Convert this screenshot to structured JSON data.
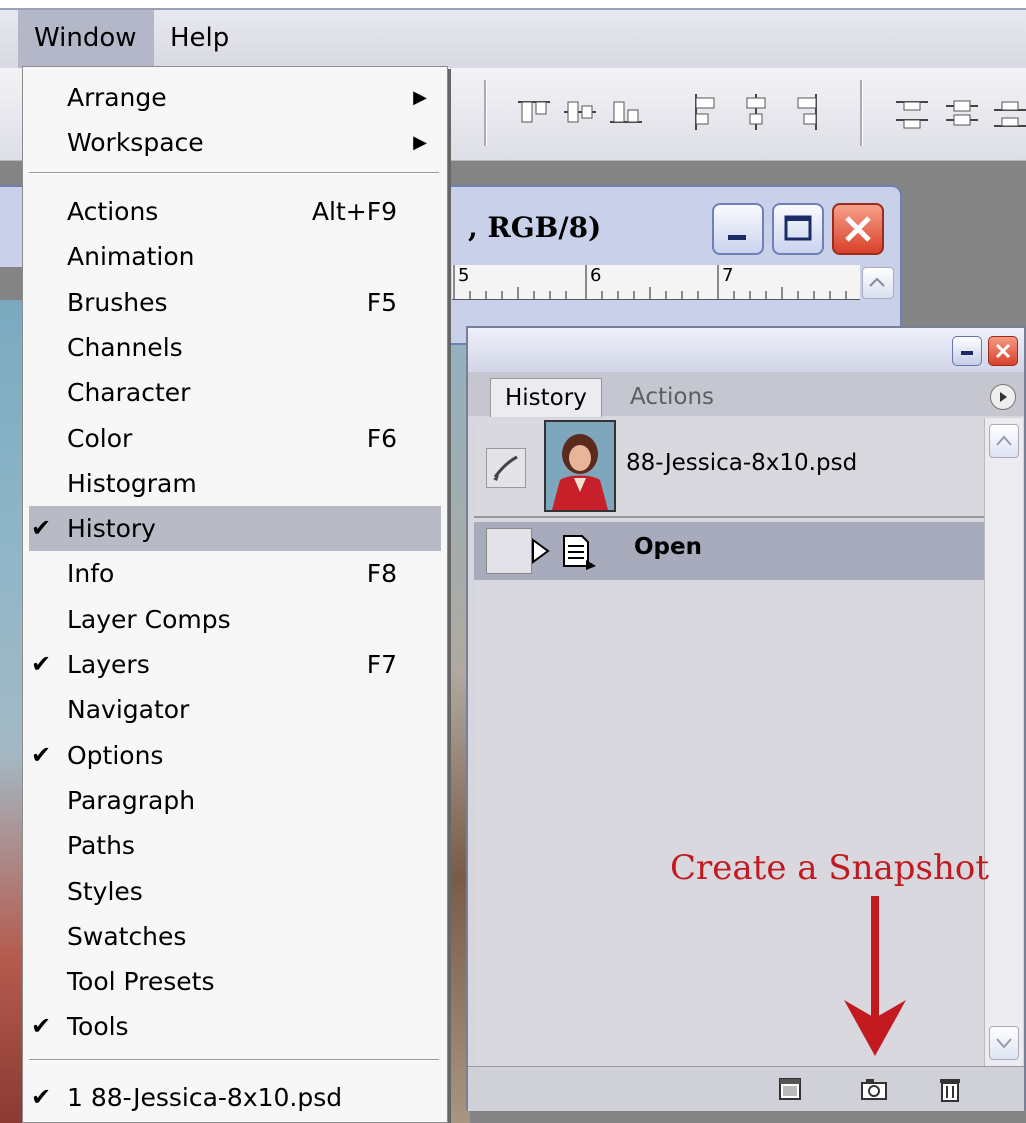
{
  "menubar": {
    "window": "Window",
    "help": "Help"
  },
  "menu": {
    "top_items": [
      {
        "label": "Arrange",
        "submenu": true
      },
      {
        "label": "Workspace",
        "submenu": true
      }
    ],
    "items": [
      {
        "label": "Actions",
        "shortcut": "Alt+F9",
        "checked": false
      },
      {
        "label": "Animation",
        "shortcut": "",
        "checked": false
      },
      {
        "label": "Brushes",
        "shortcut": "F5",
        "checked": false
      },
      {
        "label": "Channels",
        "shortcut": "",
        "checked": false
      },
      {
        "label": "Character",
        "shortcut": "",
        "checked": false
      },
      {
        "label": "Color",
        "shortcut": "F6",
        "checked": false
      },
      {
        "label": "Histogram",
        "shortcut": "",
        "checked": false
      },
      {
        "label": "History",
        "shortcut": "",
        "checked": true,
        "highlighted": true
      },
      {
        "label": "Info",
        "shortcut": "F8",
        "checked": false
      },
      {
        "label": "Layer Comps",
        "shortcut": "",
        "checked": false
      },
      {
        "label": "Layers",
        "shortcut": "F7",
        "checked": true
      },
      {
        "label": "Navigator",
        "shortcut": "",
        "checked": false
      },
      {
        "label": "Options",
        "shortcut": "",
        "checked": true
      },
      {
        "label": "Paragraph",
        "shortcut": "",
        "checked": false
      },
      {
        "label": "Paths",
        "shortcut": "",
        "checked": false
      },
      {
        "label": "Styles",
        "shortcut": "",
        "checked": false
      },
      {
        "label": "Swatches",
        "shortcut": "",
        "checked": false
      },
      {
        "label": "Tool Presets",
        "shortcut": "",
        "checked": false
      },
      {
        "label": "Tools",
        "shortcut": "",
        "checked": true
      }
    ],
    "document": {
      "label": "1 88-Jessica-8x10.psd",
      "checked": true
    },
    "check_glyph": "✔",
    "submenu_glyph": "▶"
  },
  "document_window": {
    "title": ", RGB/8)",
    "ruler": [
      "5",
      "6",
      "7"
    ]
  },
  "history_palette": {
    "tabs": [
      "History",
      "Actions"
    ],
    "snapshot_name": "88-Jessica-8x10.psd",
    "state_name": "Open"
  },
  "annotation": {
    "text": "Create a Snapshot",
    "color": "#c21a20"
  }
}
